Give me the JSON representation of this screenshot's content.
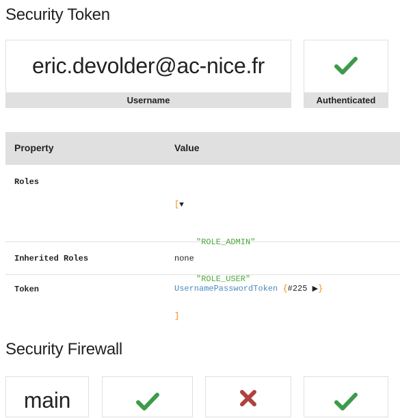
{
  "token_section": {
    "title": "Security Token",
    "username_value": "eric.devolder@ac-nice.fr",
    "username_label": "Username",
    "authenticated_label": "Authenticated",
    "authenticated_icon": "checkmark-icon"
  },
  "table": {
    "headers": [
      "Property",
      "Value"
    ],
    "rows": [
      {
        "property": "Roles",
        "value_open": "[",
        "value_toggle": "▼",
        "value_items": [
          "\"ROLE_ADMIN\"",
          "\"ROLE_USER\""
        ],
        "value_close": "]"
      },
      {
        "property": "Inherited Roles",
        "value": "none"
      },
      {
        "property": "Token",
        "value_class": "UsernamePasswordToken",
        "value_open": "{",
        "value_ref": "#225",
        "value_toggle": "▶",
        "value_close": "}"
      }
    ]
  },
  "firewall_section": {
    "title": "Security Firewall",
    "name_value": "main",
    "status_icons": [
      "checkmark-icon",
      "checkmark-icon",
      "cross-icon",
      "checkmark-icon"
    ]
  },
  "colors": {
    "ok_green": "#3d9b4a",
    "fail_red": "#b0413e",
    "header_gray": "#e0e0e0",
    "link_blue": "#4a8abf",
    "string_green": "#4aa83a",
    "bracket_orange": "#ff8400"
  }
}
